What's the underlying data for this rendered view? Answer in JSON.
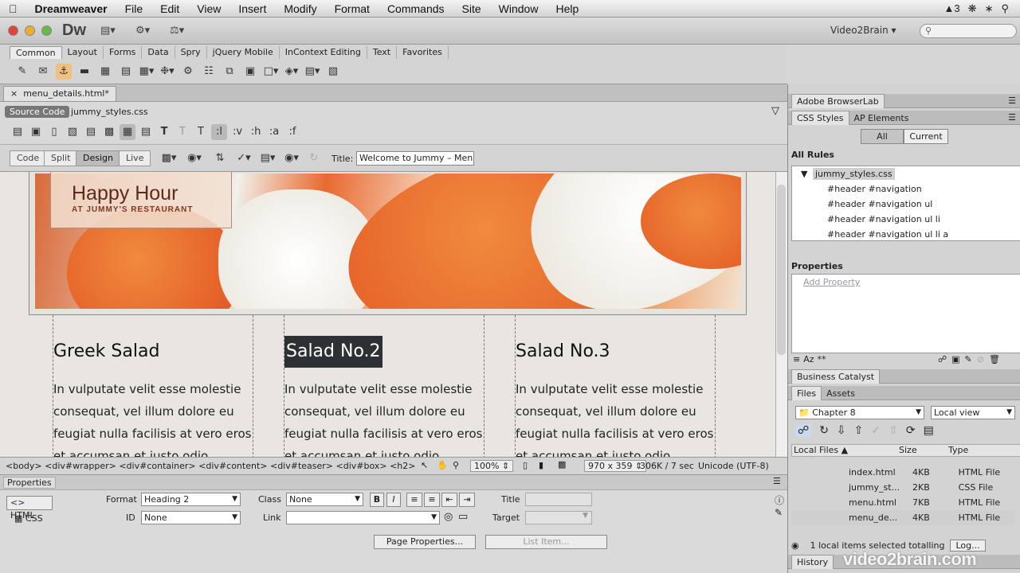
{
  "menubar": {
    "apple": "",
    "app": "Dreamweaver",
    "items": [
      "File",
      "Edit",
      "View",
      "Insert",
      "Modify",
      "Format",
      "Commands",
      "Site",
      "Window",
      "Help"
    ],
    "status_count": "3"
  },
  "appbar": {
    "logo": "Dw",
    "workspace": "Video2Brain"
  },
  "insert": {
    "tabs": [
      "Common",
      "Layout",
      "Forms",
      "Data",
      "Spry",
      "jQuery Mobile",
      "InContext Editing",
      "Text",
      "Favorites"
    ]
  },
  "document": {
    "tab": "menu_details.html*",
    "source_code": "Source Code",
    "related_file": "jummy_styles.css",
    "views": [
      "Code",
      "Split",
      "Design",
      "Live"
    ],
    "title_label": "Title:",
    "title_value": "Welcome to Jummy – Menu De"
  },
  "page": {
    "happy_title": "Happy Hour",
    "happy_sub": "AT JUMMY'S RESTAURANT",
    "columns": [
      {
        "title": "Greek Salad",
        "text": "In vulputate velit esse molestie consequat, vel illum dolore eu feugiat nulla facilisis at vero eros et accumsan et iusto odio"
      },
      {
        "title": "Salad No.2",
        "text": "In vulputate velit esse molestie consequat, vel illum dolore eu feugiat nulla facilisis at vero eros et accumsan et iusto odio"
      },
      {
        "title": "Salad No.3",
        "text": "In vulputate velit esse molestie consequat, vel illum dolore eu feugiat nulla facilisis at vero eros et accumsan et iusto odio"
      }
    ]
  },
  "status": {
    "tag_selector": "<body> <div#wrapper> <div#container> <div#content> <div#teaser> <div#box> <h2>",
    "zoom": "100%",
    "window_size": "970 x 359",
    "download": "306K / 7 sec",
    "encoding": "Unicode (UTF-8)"
  },
  "properties": {
    "title": "Properties",
    "html_label": "HTML",
    "css_label": "CSS",
    "format_label": "Format",
    "format_value": "Heading 2",
    "id_label": "ID",
    "id_value": "None",
    "class_label": "Class",
    "class_value": "None",
    "link_label": "Link",
    "title_label": "Title",
    "target_label": "Target",
    "page_properties": "Page Properties...",
    "list_item": "List Item..."
  },
  "right_panel": {
    "browserlab": "Adobe BrowserLab",
    "css_styles_tab": "CSS Styles",
    "ap_elements_tab": "AP Elements",
    "all": "All",
    "current": "Current",
    "all_rules": "All Rules",
    "rules": [
      "jummy_styles.css",
      "#header #navigation",
      "#header #navigation ul",
      "#header #navigation ul li",
      "#header #navigation ul li a"
    ],
    "properties": "Properties",
    "add_property": "Add Property",
    "business_catalyst": "Business Catalyst",
    "files_tab": "Files",
    "assets_tab": "Assets",
    "site": "Chapter 8",
    "view": "Local view",
    "col_local": "Local Files",
    "col_size": "Size",
    "col_type": "Type",
    "files": [
      {
        "name": "index.html",
        "size": "4KB",
        "type": "HTML File"
      },
      {
        "name": "jummy_st...",
        "size": "2KB",
        "type": "CSS File"
      },
      {
        "name": "menu.html",
        "size": "7KB",
        "type": "HTML File"
      },
      {
        "name": "menu_de...",
        "size": "4KB",
        "type": "HTML File"
      }
    ],
    "status": "1 local items selected totalling",
    "log": "Log...",
    "history": "History"
  },
  "watermark": "video2brain.com"
}
